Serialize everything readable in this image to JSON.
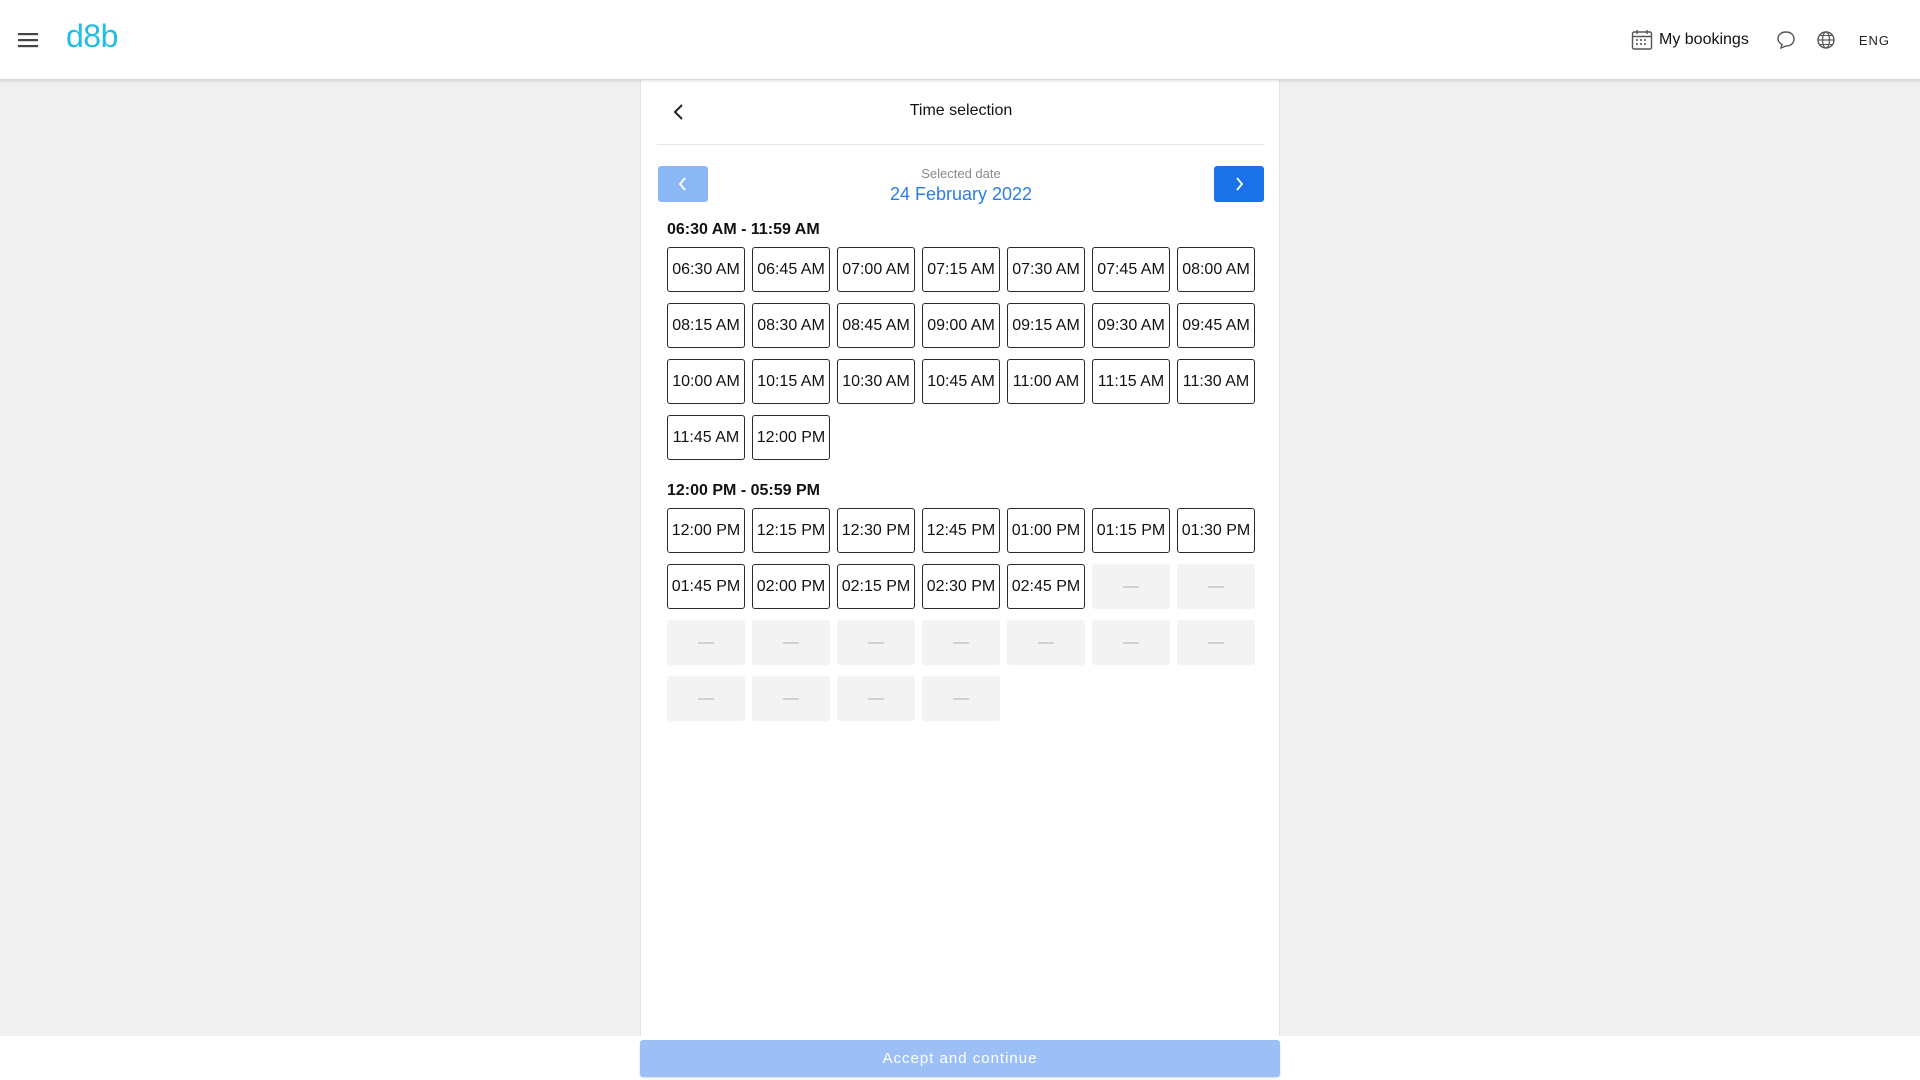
{
  "header": {
    "logo": "d8b",
    "bookings_label": "My bookings",
    "language": "ENG",
    "icons": [
      "menu-icon",
      "calendar-icon",
      "chat-icon",
      "globe-icon"
    ]
  },
  "panel": {
    "title": "Time selection",
    "date_caption": "Selected date",
    "date_value": "24 February 2022"
  },
  "morning": {
    "label": "06:30 AM - 11:59 AM",
    "slots": [
      "06:30 AM",
      "06:45 AM",
      "07:00 AM",
      "07:15 AM",
      "07:30 AM",
      "07:45 AM",
      "08:00 AM",
      "08:15 AM",
      "08:30 AM",
      "08:45 AM",
      "09:00 AM",
      "09:15 AM",
      "09:30 AM",
      "09:45 AM",
      "10:00 AM",
      "10:15 AM",
      "10:30 AM",
      "10:45 AM",
      "11:00 AM",
      "11:15 AM",
      "11:30 AM",
      "11:45 AM",
      "12:00 PM"
    ]
  },
  "afternoon": {
    "label": "12:00 PM - 05:59 PM",
    "slots": [
      "12:00 PM",
      "12:15 PM",
      "12:30 PM",
      "12:45 PM",
      "01:00 PM",
      "01:15 PM",
      "01:30 PM",
      "01:45 PM",
      "02:00 PM",
      "02:15 PM",
      "02:30 PM",
      "02:45 PM"
    ],
    "unavailable_marker": "—",
    "unavailable_count": 13
  },
  "footer": {
    "accept_label": "Accept and continue"
  },
  "colors": {
    "brand": "#22bde0",
    "primary": "#1a73e8",
    "primary_disabled": "#9cc0f5",
    "date_text": "#2b7de9"
  }
}
